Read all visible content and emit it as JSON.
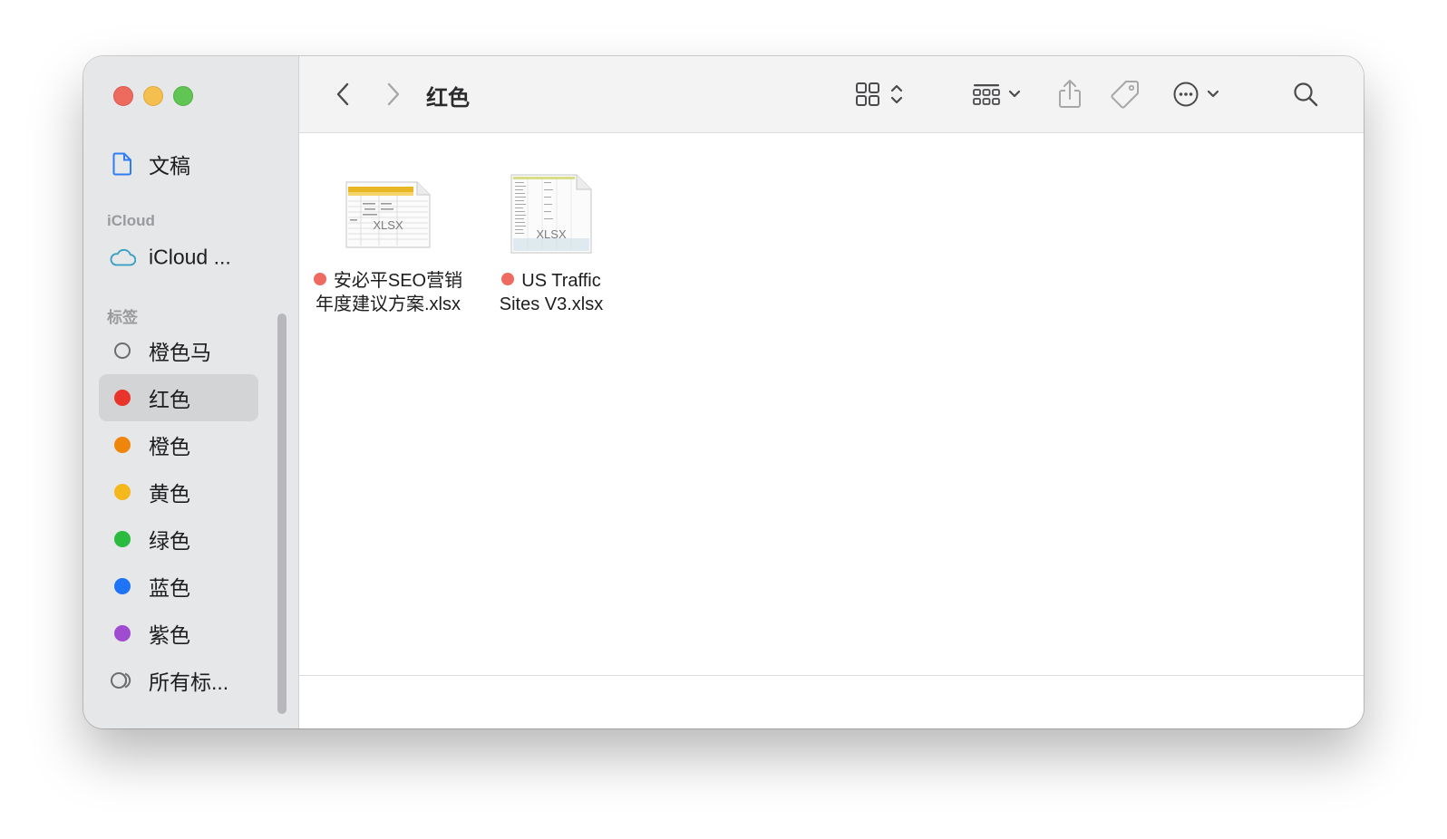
{
  "window": {
    "title": "红色"
  },
  "sidebar": {
    "favorites": [
      {
        "label": "文稿",
        "icon": "document-icon"
      }
    ],
    "icloud_section": "iCloud",
    "icloud_items": [
      {
        "label": "iCloud ...",
        "icon": "cloud-icon"
      }
    ],
    "tags_section": "标签",
    "tags": [
      {
        "label": "橙色马",
        "color": "hollow",
        "selected": false
      },
      {
        "label": "红色",
        "color": "#e8342b",
        "selected": true
      },
      {
        "label": "橙色",
        "color": "#f0850c",
        "selected": false
      },
      {
        "label": "黄色",
        "color": "#f4b71c",
        "selected": false
      },
      {
        "label": "绿色",
        "color": "#2abb3f",
        "selected": false
      },
      {
        "label": "蓝色",
        "color": "#1f74f5",
        "selected": false
      },
      {
        "label": "紫色",
        "color": "#a04cd0",
        "selected": false
      },
      {
        "label": "所有标...",
        "color": "all-tags-icon",
        "selected": false
      }
    ]
  },
  "files": [
    {
      "name_line1": "安必平SEO营销",
      "name_line2": "年度建议方案.xlsx",
      "tag_color": "#ef6a61",
      "badge": "XLSX"
    },
    {
      "name_line1": "US Traffic",
      "name_line2": "Sites V3.xlsx",
      "tag_color": "#ef6a61",
      "badge": "XLSX"
    }
  ]
}
